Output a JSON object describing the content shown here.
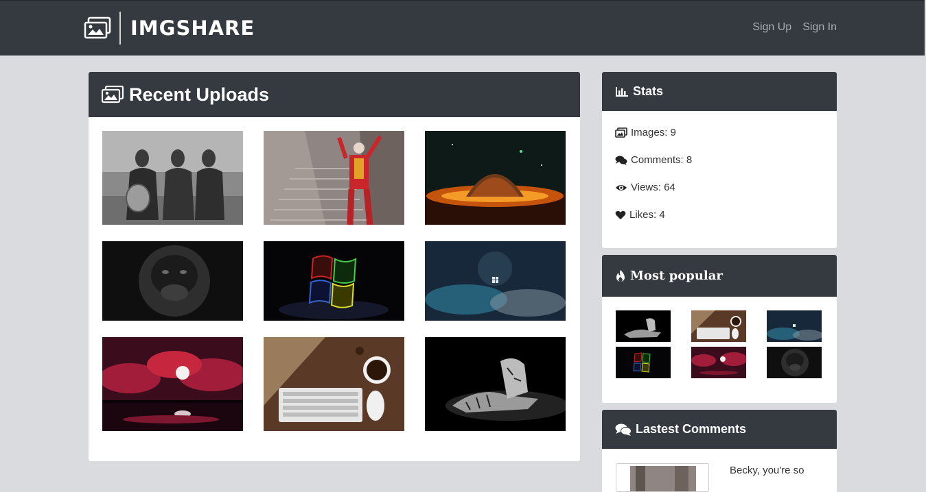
{
  "brand": {
    "name": "IMGSHARE"
  },
  "nav": {
    "signup": "Sign Up",
    "signin": "Sign In"
  },
  "recent": {
    "title": "Recent Uploads",
    "images": [
      "three-men-vintage-photo",
      "joker-on-stairs",
      "planet-ring-space",
      "gorilla-dark",
      "windows-logo-dark",
      "windows-blue-wallpaper",
      "red-clouds-moon",
      "keyboard-coffee-desk",
      "tiger-black-white"
    ]
  },
  "stats": {
    "title": "Stats",
    "images": "Images: 9",
    "comments": "Comments: 8",
    "views": "Views: 64",
    "likes": "Likes: 4"
  },
  "popular": {
    "title": "Most popular"
  },
  "latest_comments": {
    "title": "Lastest Comments",
    "first_text": "Becky, you're so"
  }
}
